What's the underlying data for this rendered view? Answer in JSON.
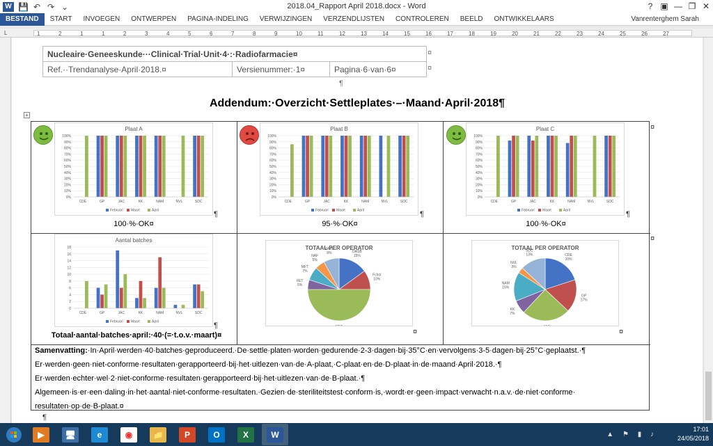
{
  "window": {
    "title": "2018.04_Rapport April 2018.docx - Word",
    "help": "?",
    "minimize": "—",
    "restore": "❐",
    "close": "✕"
  },
  "qat": {
    "app_logo": "W",
    "save": "💾",
    "undo": "↶",
    "redo": "↷",
    "customize": "⌄"
  },
  "ribbon": {
    "tabs": [
      "BESTAND",
      "START",
      "INVOEGEN",
      "ONTWERPEN",
      "PAGINA-INDELING",
      "VERWIJZINGEN",
      "VERZENDLIJSTEN",
      "CONTROLEREN",
      "BEELD",
      "ONTWIKKELAARS"
    ],
    "user": "Vanrenterghem Sarah"
  },
  "ruler": {
    "left_marker": "L",
    "ticks": [
      "1",
      "2",
      "1",
      "1",
      "2",
      "3",
      "4",
      "5",
      "6",
      "7",
      "8",
      "9",
      "10",
      "11",
      "12",
      "13",
      "14",
      "15",
      "16",
      "17",
      "18",
      "19",
      "20",
      "21",
      "22",
      "23",
      "24",
      "25",
      "26",
      "27"
    ]
  },
  "header_table": {
    "row1": "Nucleaire·Geneeskunde···Clinical·Trial·Unit·4·:·Radiofarmacie¤",
    "ref": "Ref.··Trendanalyse·April·2018.¤",
    "version": "Versienummer:·1¤",
    "page": "Pagina·6·van·6¤",
    "cell_mark": "¤",
    "para_mark": "¶"
  },
  "doc_title": "Addendum:·Overzicht·Settleplates·–·Maand·April·2018¶",
  "table_handle": "+",
  "marks": {
    "cell": "¤",
    "para": "¶"
  },
  "colors": {
    "februari": "#4472c4",
    "maart": "#c0504d",
    "april": "#9bbb59",
    "smiley_ok": "#7ebb41",
    "smiley_nok": "#e04a43"
  },
  "captions": {
    "plaat_a": "100·%·OK¤",
    "plaat_b": "95·%·OK¤",
    "plaat_c": "100·%·OK¤",
    "batches": "Totaal·aantal·batches·april:·40·(=·t.o.v.·maart)¤"
  },
  "chart_data": [
    {
      "type": "bar",
      "title": "Plaat A",
      "categories": [
        "CDE",
        "GP",
        "JAC",
        "KK",
        "NAM",
        "NVL",
        "SDC"
      ],
      "yticks": [
        "0%",
        "10%",
        "20%",
        "30%",
        "40%",
        "50%",
        "60%",
        "70%",
        "80%",
        "90%",
        "100%"
      ],
      "ylim": [
        0,
        100
      ],
      "legend": "bottom",
      "series": [
        {
          "name": "Februari",
          "values": [
            [],
            [
              100
            ],
            [
              100,
              100
            ],
            [
              100,
              100
            ],
            [
              100,
              100
            ],
            [
              100
            ],
            [
              100,
              100
            ]
          ]
        },
        {
          "name": "Maart",
          "values": [
            [],
            [
              100
            ],
            [
              100,
              100
            ],
            [
              100,
              100
            ],
            [
              100,
              100
            ],
            [
              100
            ],
            [
              100,
              100
            ]
          ]
        },
        {
          "name": "April",
          "values": [
            [
              100
            ],
            [
              100
            ],
            [
              100
            ],
            [
              100
            ],
            [
              100
            ],
            [
              100
            ],
            [
              100
            ]
          ]
        }
      ],
      "bars": [
        {
          "c": 0,
          "s": "April",
          "v": 100
        },
        {
          "c": 1,
          "s": "Februari",
          "v": 100
        },
        {
          "c": 1,
          "s": "Maart",
          "v": 100
        },
        {
          "c": 1,
          "s": "April",
          "v": 100
        },
        {
          "c": 2,
          "s": "Februari",
          "v": 100
        },
        {
          "c": 2,
          "s": "Maart",
          "v": 100
        },
        {
          "c": 2,
          "s": "April",
          "v": 100
        },
        {
          "c": 3,
          "s": "Februari",
          "v": 100
        },
        {
          "c": 3,
          "s": "Maart",
          "v": 100
        },
        {
          "c": 3,
          "s": "April",
          "v": 100
        },
        {
          "c": 4,
          "s": "Februari",
          "v": 100
        },
        {
          "c": 4,
          "s": "Maart",
          "v": 100
        },
        {
          "c": 4,
          "s": "April",
          "v": 100
        },
        {
          "c": 5,
          "s": "April",
          "v": 100
        },
        {
          "c": 6,
          "s": "Februari",
          "v": 100
        },
        {
          "c": 6,
          "s": "Maart",
          "v": 100
        },
        {
          "c": 6,
          "s": "April",
          "v": 100
        }
      ]
    },
    {
      "type": "bar",
      "title": "Plaat B",
      "categories": [
        "CDE",
        "GP",
        "JAC",
        "KK",
        "NAM",
        "NVL",
        "SDC"
      ],
      "yticks": [
        "0%",
        "10%",
        "20%",
        "30%",
        "40%",
        "50%",
        "60%",
        "70%",
        "80%",
        "90%",
        "100%"
      ],
      "ylim": [
        0,
        100
      ],
      "legend": "bottom",
      "bars": [
        {
          "c": 0,
          "s": "April",
          "v": 86
        },
        {
          "c": 1,
          "s": "Februari",
          "v": 100
        },
        {
          "c": 1,
          "s": "Maart",
          "v": 100
        },
        {
          "c": 1,
          "s": "April",
          "v": 100
        },
        {
          "c": 2,
          "s": "Februari",
          "v": 100
        },
        {
          "c": 2,
          "s": "Maart",
          "v": 100
        },
        {
          "c": 2,
          "s": "April",
          "v": 100
        },
        {
          "c": 3,
          "s": "Februari",
          "v": 100
        },
        {
          "c": 3,
          "s": "Maart",
          "v": 100
        },
        {
          "c": 3,
          "s": "April",
          "v": 100
        },
        {
          "c": 4,
          "s": "Februari",
          "v": 100
        },
        {
          "c": 4,
          "s": "Maart",
          "v": 100
        },
        {
          "c": 4,
          "s": "April",
          "v": 100
        },
        {
          "c": 5,
          "s": "Februari",
          "v": 100
        },
        {
          "c": 5,
          "s": "April",
          "v": 100
        },
        {
          "c": 6,
          "s": "Februari",
          "v": 100
        },
        {
          "c": 6,
          "s": "Maart",
          "v": 100
        },
        {
          "c": 6,
          "s": "April",
          "v": 100
        }
      ]
    },
    {
      "type": "bar",
      "title": "Plaat C",
      "categories": [
        "CDE",
        "GP",
        "JAC",
        "KK",
        "NAM",
        "NVL",
        "SDC"
      ],
      "yticks": [
        "0%",
        "10%",
        "20%",
        "30%",
        "40%",
        "50%",
        "60%",
        "70%",
        "80%",
        "90%",
        "100%"
      ],
      "ylim": [
        0,
        100
      ],
      "legend": "bottom",
      "bars": [
        {
          "c": 0,
          "s": "April",
          "v": 100
        },
        {
          "c": 1,
          "s": "Februari",
          "v": 92
        },
        {
          "c": 1,
          "s": "Maart",
          "v": 100
        },
        {
          "c": 1,
          "s": "April",
          "v": 100
        },
        {
          "c": 2,
          "s": "Februari",
          "v": 100
        },
        {
          "c": 2,
          "s": "Maart",
          "v": 92
        },
        {
          "c": 2,
          "s": "April",
          "v": 100
        },
        {
          "c": 3,
          "s": "Februari",
          "v": 100
        },
        {
          "c": 3,
          "s": "Maart",
          "v": 100
        },
        {
          "c": 3,
          "s": "April",
          "v": 100
        },
        {
          "c": 4,
          "s": "Februari",
          "v": 88
        },
        {
          "c": 4,
          "s": "Maart",
          "v": 100
        },
        {
          "c": 4,
          "s": "April",
          "v": 100
        },
        {
          "c": 5,
          "s": "April",
          "v": 100
        },
        {
          "c": 6,
          "s": "Februari",
          "v": 100
        },
        {
          "c": 6,
          "s": "Maart",
          "v": 100
        },
        {
          "c": 6,
          "s": "April",
          "v": 100
        }
      ]
    },
    {
      "type": "bar",
      "title": "Aantal batches",
      "categories": [
        "CDE",
        "GP",
        "JAC",
        "KK",
        "NAM",
        "NVL",
        "SDC"
      ],
      "yticks": [
        "0",
        "2",
        "4",
        "6",
        "8",
        "10",
        "12",
        "14",
        "16",
        "18"
      ],
      "ylim": [
        0,
        18
      ],
      "legend": "bottom",
      "series": [
        {
          "name": "Februari",
          "values": [
            0,
            6,
            17,
            3,
            6,
            1,
            7
          ]
        },
        {
          "name": "Maart",
          "values": [
            0,
            4,
            6,
            8,
            15,
            0,
            7
          ]
        },
        {
          "name": "April",
          "values": [
            8,
            7,
            10,
            3,
            6,
            1,
            5
          ]
        }
      ]
    },
    {
      "type": "pie",
      "title": "TOTAAL PER OPERATOR",
      "slices": [
        {
          "label": "DASB",
          "value": 15,
          "text": "DASB\n15%",
          "color": "#4472c4"
        },
        {
          "label": "Fchol",
          "value": 10,
          "text": "Fchol\n10%",
          "color": "#c0504d"
        },
        {
          "label": "FDG",
          "value": 50,
          "text": "FDG\n50%",
          "color": "#9bbb59"
        },
        {
          "label": "FET",
          "value": 5,
          "text": "FET\n5%",
          "color": "#8064a2"
        },
        {
          "label": "MFT",
          "value": 7,
          "text": "MFT\n7%",
          "color": "#4bacc6"
        },
        {
          "label": "NAF",
          "value": 5,
          "text": "NAF\n5%",
          "color": "#f79646"
        },
        {
          "label": "RACL",
          "value": 8,
          "text": "RACL\n8%",
          "color": "#95b3d7"
        }
      ]
    },
    {
      "type": "pie",
      "title": "TOTAAL PER OPERATOR",
      "slices": [
        {
          "label": "CDE",
          "value": 20,
          "text": "CDE\n20%",
          "color": "#4472c4"
        },
        {
          "label": "GP",
          "value": 17,
          "text": "GP\n17%",
          "color": "#c0504d"
        },
        {
          "label": "JAC",
          "value": 25,
          "text": "JAC\n25%",
          "color": "#9bbb59"
        },
        {
          "label": "KK",
          "value": 7,
          "text": "KK\n7%",
          "color": "#8064a2"
        },
        {
          "label": "NAM",
          "value": 15,
          "text": "NAM\n15%",
          "color": "#4bacc6"
        },
        {
          "label": "NVL",
          "value": 3,
          "text": "NVL\n3%",
          "color": "#f79646"
        },
        {
          "label": "SDC",
          "value": 13,
          "text": "SDC\n13%",
          "color": "#95b3d7"
        }
      ]
    }
  ],
  "legend_labels": [
    "Februari",
    "Maart",
    "April"
  ],
  "summary": {
    "label": "Samenvatting:",
    "line1": "·In·April·werden·40·batches·geproduceerd.·De·settle·platen·worden·gedurende·2-3·dagen·bij·35°C·en·vervolgens·3-5·dagen·bij·25°C·geplaatst.·¶",
    "line2": "Er·werden·geen·niet-conforme·resultaten·gerapporteerd·bij·het·uitlezen·van·de·A-plaat,·C-plaat·en·de·D-plaat·in·de·maand·April·2018.·¶",
    "line3": "Er·werden·echter·wel·2·niet-conforme·resultaten·gerapporteerd·bij·het·uitlezen·van·de·B-plaat.·¶",
    "line4": "Algemeen·is·er·een·daling·in·het·aantal·niet-conforme·resultaten.·Gezien·de·steriliteitstest·conform·is,·wordt·er·geen·impact·verwacht·n.a.v.·de·niet·conforme·",
    "line5": "resultaten·op·de·B-plaat.¤"
  },
  "trailing_para": "¶",
  "taskbar": {
    "time": "17:01",
    "date": "24/05/2018",
    "apps": [
      "Media Player",
      "Computer",
      "Internet Explorer",
      "Chrome",
      "Explorer",
      "PowerPoint",
      "Outlook",
      "Excel",
      "Word"
    ],
    "app_letters": [
      "▶",
      "🖥",
      "e",
      "◉",
      "📁",
      "P",
      "O",
      "X",
      "W"
    ]
  }
}
